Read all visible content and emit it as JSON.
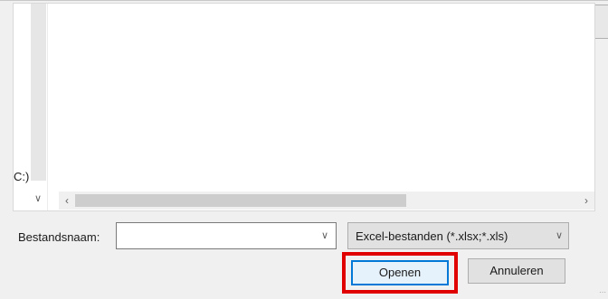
{
  "nav": {
    "drive_label": "C:)",
    "collapse_icon": "chevron-down-icon"
  },
  "scroll": {
    "left_icon": "arrow-left-icon",
    "right_icon": "arrow-right-icon"
  },
  "filename": {
    "label": "Bestandsnaam:",
    "value": "",
    "dropdown_icon": "chevron-down-icon"
  },
  "filter": {
    "selected": "Excel-bestanden (*.xlsx;*.xls)",
    "dropdown_icon": "chevron-down-icon"
  },
  "buttons": {
    "open_label": "Openen",
    "cancel_label": "Annuleren"
  },
  "colors": {
    "highlight": "#e00000",
    "focus_border": "#0078d7"
  }
}
